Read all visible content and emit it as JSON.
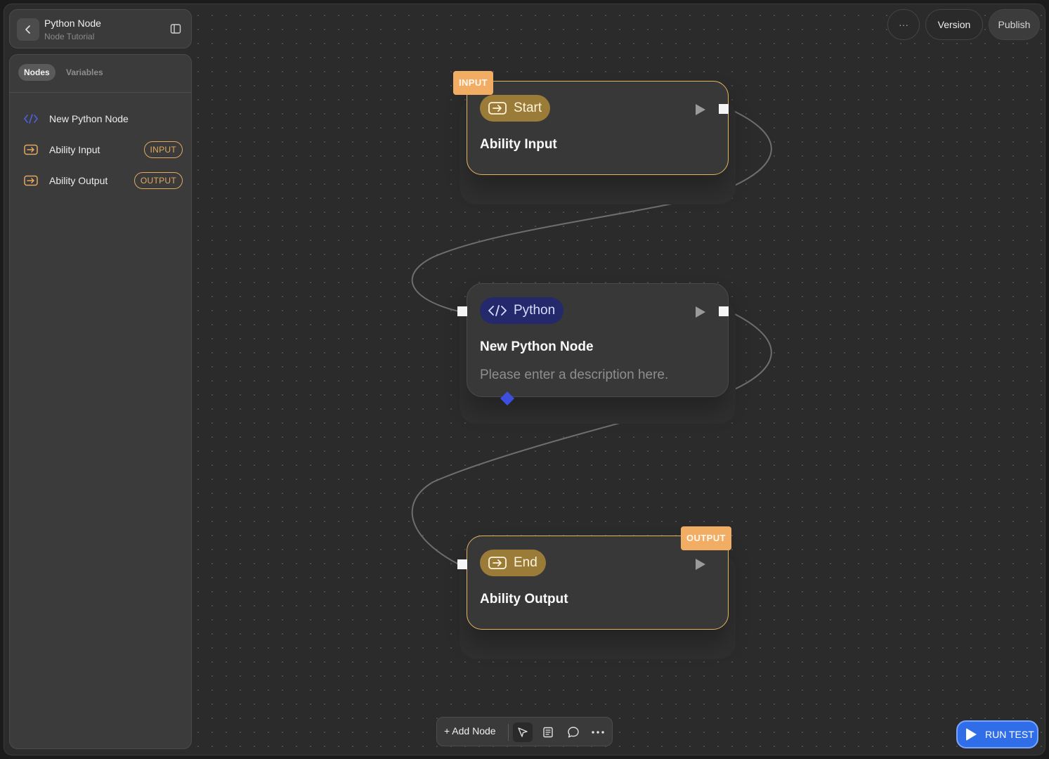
{
  "header": {
    "title": "Python Node",
    "subtitle": "Node Tutorial"
  },
  "sidebar": {
    "tabs": [
      {
        "label": "Nodes",
        "active": true
      },
      {
        "label": "Variables",
        "active": false
      }
    ],
    "items": [
      {
        "label": "New Python Node",
        "icon": "code-icon",
        "badge": ""
      },
      {
        "label": "Ability Input",
        "icon": "input-arrow-icon",
        "badge": "INPUT"
      },
      {
        "label": "Ability Output",
        "icon": "input-arrow-icon",
        "badge": "OUTPUT"
      }
    ]
  },
  "topbar": {
    "more_label": "···",
    "version_label": "Version",
    "publish_label": "Publish"
  },
  "nodes": {
    "start": {
      "tag": "INPUT",
      "type_label": "Start",
      "title": "Ability Input"
    },
    "python": {
      "type_label": "Python",
      "title": "New Python Node",
      "description": "Please enter a description here."
    },
    "end": {
      "tag": "OUTPUT",
      "type_label": "End",
      "title": "Ability Output"
    }
  },
  "toolbar": {
    "add_node_label": "+ Add Node"
  },
  "run_test": {
    "label": "RUN TEST"
  },
  "colors": {
    "io_accent": "#e6b45e",
    "python_pill": "#23296b",
    "run_button": "#2f6ee8"
  }
}
